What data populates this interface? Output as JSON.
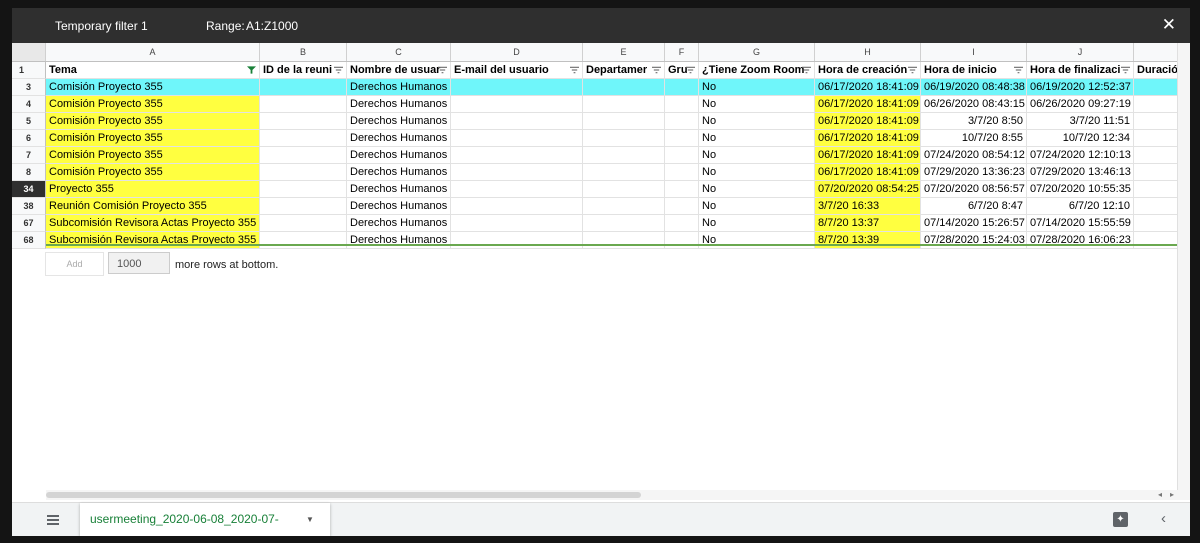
{
  "filter_bar": {
    "name": "Temporary filter 1",
    "range_label": "Range:",
    "range_value": "A1:Z1000",
    "close_icon": "close-icon"
  },
  "column_letters": [
    "A",
    "B",
    "C",
    "D",
    "E",
    "F",
    "G",
    "H",
    "I",
    "J"
  ],
  "headers": [
    "Tema",
    "ID de la reuni",
    "Nombre de usuar",
    "E-mail del usuario",
    "Departamer",
    "Gru",
    "¿Tiene Zoom Room",
    "Hora de creación",
    "Hora de inicio",
    "Hora de finalizaci",
    "Duración"
  ],
  "rows": [
    {
      "num": "3",
      "cells": [
        "Comisión Proyecto 355",
        "",
        "Derechos Humanos",
        "",
        "",
        "",
        "No",
        "06/17/2020 18:41:09",
        "06/19/2020 08:48:38",
        "06/19/2020 12:52:37"
      ]
    },
    {
      "num": "4",
      "cells": [
        "Comisión Proyecto 355",
        "",
        "Derechos Humanos",
        "",
        "",
        "",
        "No",
        "06/17/2020 18:41:09",
        "06/26/2020 08:43:15",
        "06/26/2020 09:27:19"
      ]
    },
    {
      "num": "5",
      "cells": [
        "Comisión Proyecto 355",
        "",
        "Derechos Humanos",
        "",
        "",
        "",
        "No",
        "06/17/2020 18:41:09",
        "3/7/20 8:50",
        "3/7/20 11:51"
      ]
    },
    {
      "num": "6",
      "cells": [
        "Comisión Proyecto 355",
        "",
        "Derechos Humanos",
        "",
        "",
        "",
        "No",
        "06/17/2020 18:41:09",
        "10/7/20 8:55",
        "10/7/20 12:34"
      ]
    },
    {
      "num": "7",
      "cells": [
        "Comisión Proyecto 355",
        "",
        "Derechos Humanos",
        "",
        "",
        "",
        "No",
        "06/17/2020 18:41:09",
        "07/24/2020 08:54:12",
        "07/24/2020 12:10:13"
      ]
    },
    {
      "num": "8",
      "cells": [
        "Comisión Proyecto 355",
        "",
        "Derechos Humanos",
        "",
        "",
        "",
        "No",
        "06/17/2020 18:41:09",
        "07/29/2020 13:36:23",
        "07/29/2020 13:46:13"
      ]
    },
    {
      "num": "34",
      "cells": [
        "Proyecto 355",
        "",
        "Derechos Humanos",
        "",
        "",
        "",
        "No",
        "07/20/2020 08:54:25",
        "07/20/2020 08:56:57",
        "07/20/2020 10:55:35"
      ]
    },
    {
      "num": "38",
      "cells": [
        "Reunión Comisión Proyecto 355",
        "",
        "Derechos Humanos",
        "",
        "",
        "",
        "No",
        "3/7/20 16:33",
        "6/7/20 8:47",
        "6/7/20 12:10"
      ]
    },
    {
      "num": "67",
      "cells": [
        "Subcomisión Revisora Actas Proyecto 355",
        "",
        "Derechos Humanos",
        "",
        "",
        "",
        "No",
        "8/7/20 13:37",
        "07/14/2020 15:26:57",
        "07/14/2020 15:55:59"
      ]
    },
    {
      "num": "68",
      "cells": [
        "Subcomisión Revisora Actas Proyecto 355",
        "",
        "Derechos Humanos",
        "",
        "",
        "",
        "No",
        "8/7/20 13:39",
        "07/28/2020 15:24:03",
        "07/28/2020 16:06:23"
      ]
    }
  ],
  "add_rows": {
    "button": "Add",
    "count": "1000",
    "suffix": "more rows at bottom."
  },
  "sheet_tab": {
    "name": "usermeeting_2020-06-08_2020-07-"
  },
  "colors": {
    "highlight_cyan": "#6ff6fa",
    "highlight_yellow": "#ffff40",
    "filter_active": "#188038",
    "sheet_tab_text": "#188038",
    "dark_bar": "#2f2f2f"
  },
  "icons": [
    "close-icon",
    "filter-icon",
    "all-sheets-icon",
    "caret-down-icon",
    "explore-icon",
    "chevron-left-icon"
  ]
}
